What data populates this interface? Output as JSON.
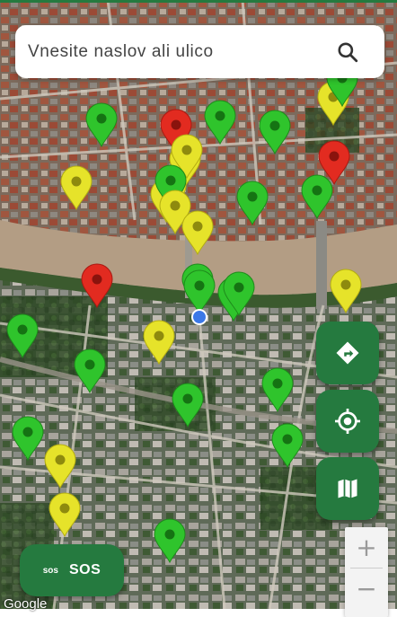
{
  "search": {
    "placeholder": "Vnesite naslov ali ulico"
  },
  "sos_button": {
    "icon_text": "sos",
    "label": "SOS"
  },
  "zoom": {
    "in_label": "+",
    "out_label": "−"
  },
  "attribution": "Google",
  "map_controls": [
    "directions-icon",
    "my-location-icon",
    "map-layers-icon"
  ],
  "colors": {
    "green": "#2fc42c",
    "yellow": "#e6e32a",
    "red": "#e22b20",
    "accent": "#257a3f",
    "user_location": "#3b78e7"
  },
  "markers": [
    {
      "status": "green"
    },
    {
      "status": "red"
    },
    {
      "status": "green"
    },
    {
      "status": "green"
    },
    {
      "status": "yellow"
    },
    {
      "status": "green"
    },
    {
      "status": "red"
    },
    {
      "status": "yellow"
    },
    {
      "status": "yellow"
    },
    {
      "status": "yellow"
    },
    {
      "status": "yellow"
    },
    {
      "status": "yellow"
    },
    {
      "status": "green"
    },
    {
      "status": "yellow"
    },
    {
      "status": "green"
    },
    {
      "status": "green"
    },
    {
      "status": "red"
    },
    {
      "status": "yellow"
    },
    {
      "status": "green"
    },
    {
      "status": "green"
    },
    {
      "status": "green"
    },
    {
      "status": "green"
    },
    {
      "status": "yellow"
    },
    {
      "status": "green"
    },
    {
      "status": "green"
    },
    {
      "status": "green"
    },
    {
      "status": "green"
    },
    {
      "status": "green"
    },
    {
      "status": "yellow"
    },
    {
      "status": "yellow"
    },
    {
      "status": "yellow"
    },
    {
      "status": "green"
    },
    {
      "status": "green"
    }
  ]
}
